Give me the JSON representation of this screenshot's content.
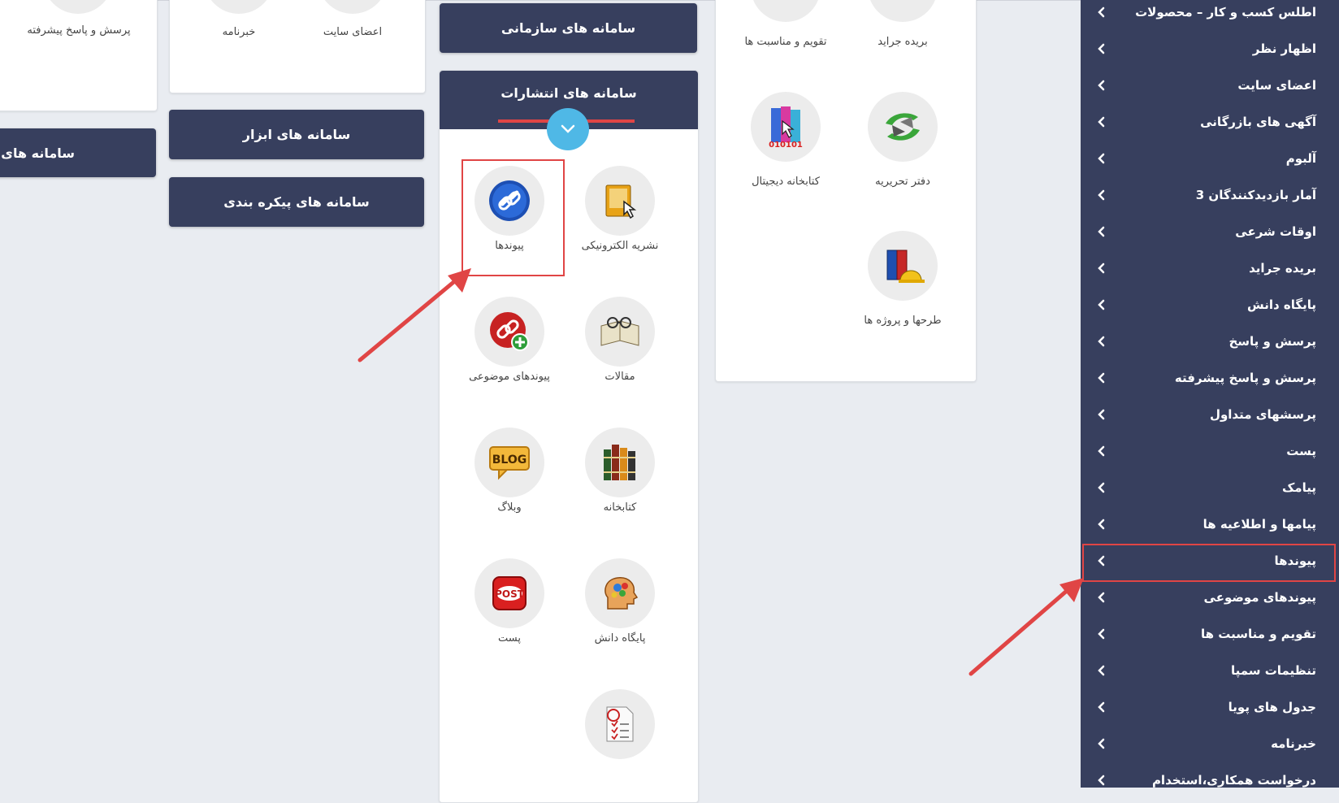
{
  "top_left_card": {
    "labels": [
      "پرسش و پاسخ پیشرفته"
    ]
  },
  "top_mid_card": {
    "labels": [
      "خبرنامه",
      "اعضای سایت"
    ]
  },
  "buttons": {
    "b_systems": "سامانه های B",
    "tools": "سامانه های ابزار",
    "config": "سامانه های پیکره بندی",
    "org": "سامانه های سازمانی",
    "publications": "سامانه های انتشارات"
  },
  "publications_icons": [
    {
      "label": "پیوندها",
      "icon": "link-icon"
    },
    {
      "label": "نشریه الکترونیکی",
      "icon": "e-newsletter-icon"
    },
    {
      "label": "پیوندهای موضوعی",
      "icon": "add-link-icon"
    },
    {
      "label": "مقالات",
      "icon": "articles-icon"
    },
    {
      "label": "وبلاگ",
      "icon": "blog-icon"
    },
    {
      "label": "کتابخانه",
      "icon": "library-books-icon"
    },
    {
      "label": "پست",
      "icon": "post-icon"
    },
    {
      "label": "پایگاه دانش",
      "icon": "knowledge-base-icon"
    },
    {
      "label": "",
      "icon": "grade-checklist-icon"
    }
  ],
  "right_panel_icons": [
    {
      "label": "تقویم و مناسبت ها",
      "icon": "calendar-icon"
    },
    {
      "label": "بریده جراید",
      "icon": "press-clippings-icon"
    },
    {
      "label": "کتابخانه دیجیتال",
      "icon": "digital-library-icon"
    },
    {
      "label": "دفتر تحریریه",
      "icon": "editorial-office-icon"
    },
    {
      "label": "طرحها و پروژه ها",
      "icon": "projects-icon"
    }
  ],
  "sidebar": {
    "items": [
      "اطلس کسب و کار – محصولات",
      "اظهار نظر",
      "اعضای سایت",
      "آگهی های بازرگانی",
      "آلبوم",
      "آمار بازدیدکنندگان 3",
      "اوقات شرعی",
      "بریده جراید",
      "پایگاه دانش",
      "پرسش و پاسخ",
      "پرسش و پاسخ پیشرفته",
      "پرسشهای متداول",
      "پست",
      "پیامک",
      "پیامها و اطلاعیه ها",
      "پیوندها",
      "پیوندهای موضوعی",
      "تقویم و مناسبت ها",
      "تنظیمات سمپا",
      "جدول های پویا",
      "خبرنامه",
      "درخواست همکاری،استخدام"
    ],
    "highlighted": "پیوندها"
  },
  "colors": {
    "navy": "#373f5e",
    "annotation_red": "#e04545",
    "toggle_blue": "#4fb8e6"
  }
}
